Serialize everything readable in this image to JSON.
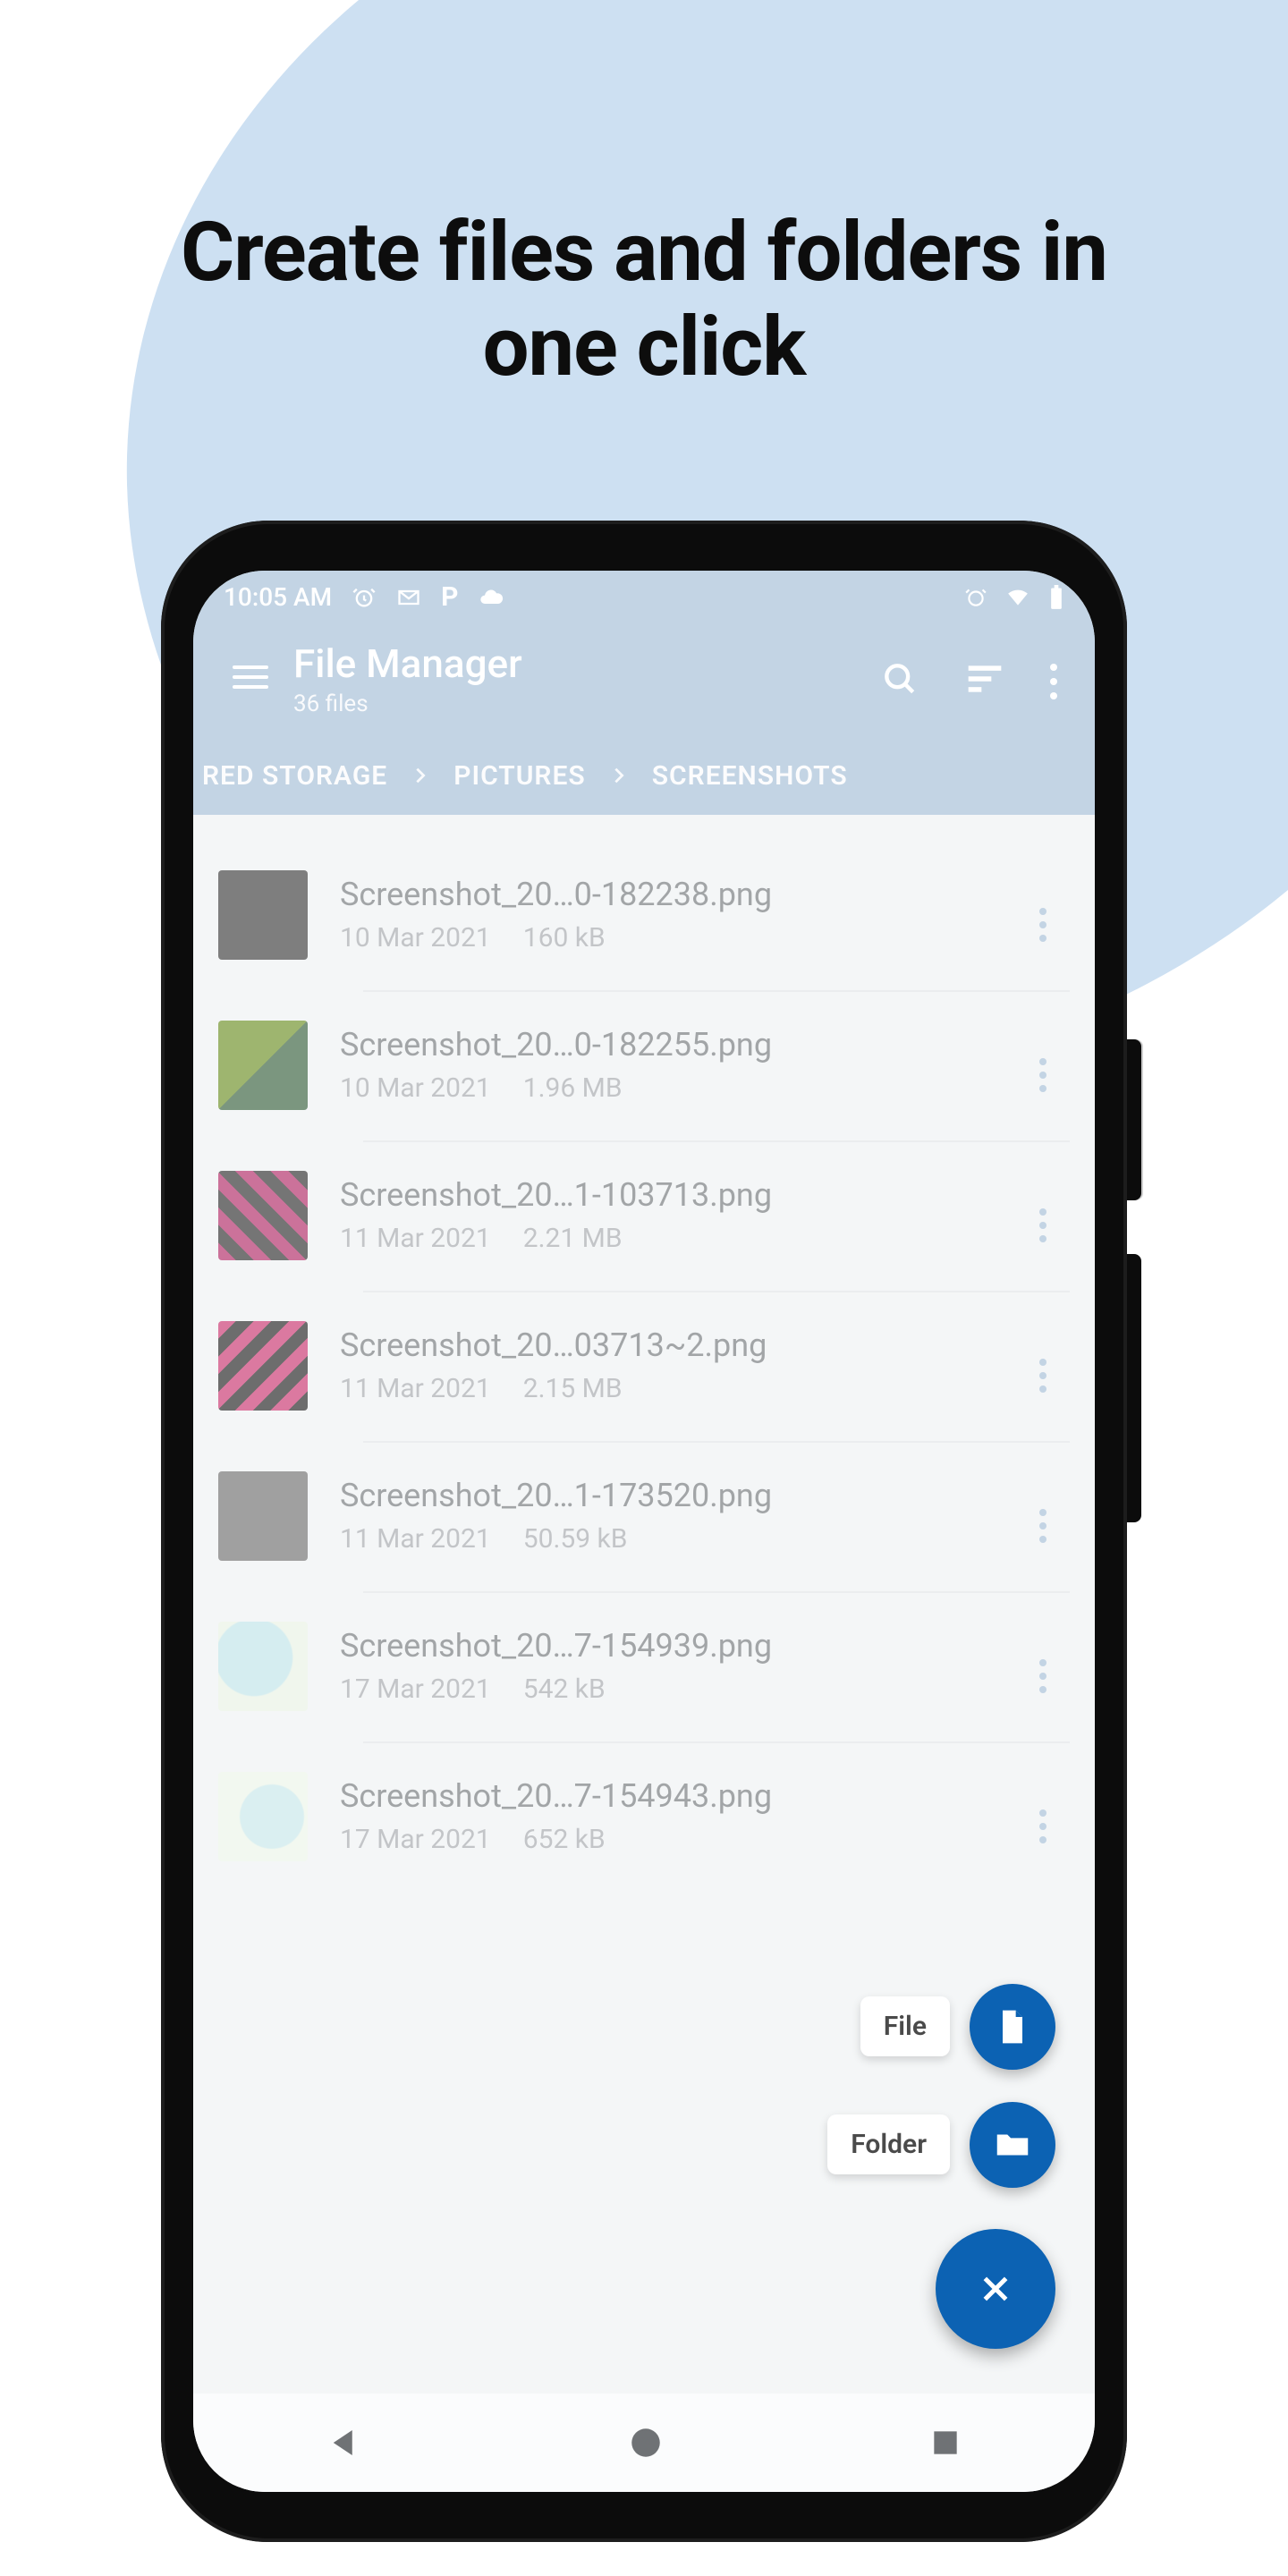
{
  "headline": "Create files and folders in one click",
  "statusbar": {
    "time": "10:05 AM"
  },
  "appbar": {
    "title": "File Manager",
    "subtitle": "36 files"
  },
  "breadcrumb": {
    "items": [
      "RED STORAGE",
      "PICTURES",
      "SCREENSHOTS"
    ]
  },
  "files": [
    {
      "name": "Screenshot_20…0-182238.png",
      "date": "10 Mar 2021",
      "size": "160 kB",
      "thumb": "th-dark"
    },
    {
      "name": "Screenshot_20…0-182255.png",
      "date": "10 Mar 2021",
      "size": "1.96 MB",
      "thumb": "th-grid"
    },
    {
      "name": "Screenshot_20…1-103713.png",
      "date": "11 Mar 2021",
      "size": "2.21 MB",
      "thumb": "th-pink"
    },
    {
      "name": "Screenshot_20…03713~2.png",
      "date": "11 Mar 2021",
      "size": "2.15 MB",
      "thumb": "th-pink2"
    },
    {
      "name": "Screenshot_20…1-173520.png",
      "date": "11 Mar 2021",
      "size": "50.59 kB",
      "thumb": "th-text"
    },
    {
      "name": "Screenshot_20…7-154939.png",
      "date": "17 Mar 2021",
      "size": "542 kB",
      "thumb": "th-map"
    },
    {
      "name": "Screenshot_20…7-154943.png",
      "date": "17 Mar 2021",
      "size": "652 kB",
      "thumb": "th-map2"
    }
  ],
  "fab": {
    "file_label": "File",
    "folder_label": "Folder"
  }
}
